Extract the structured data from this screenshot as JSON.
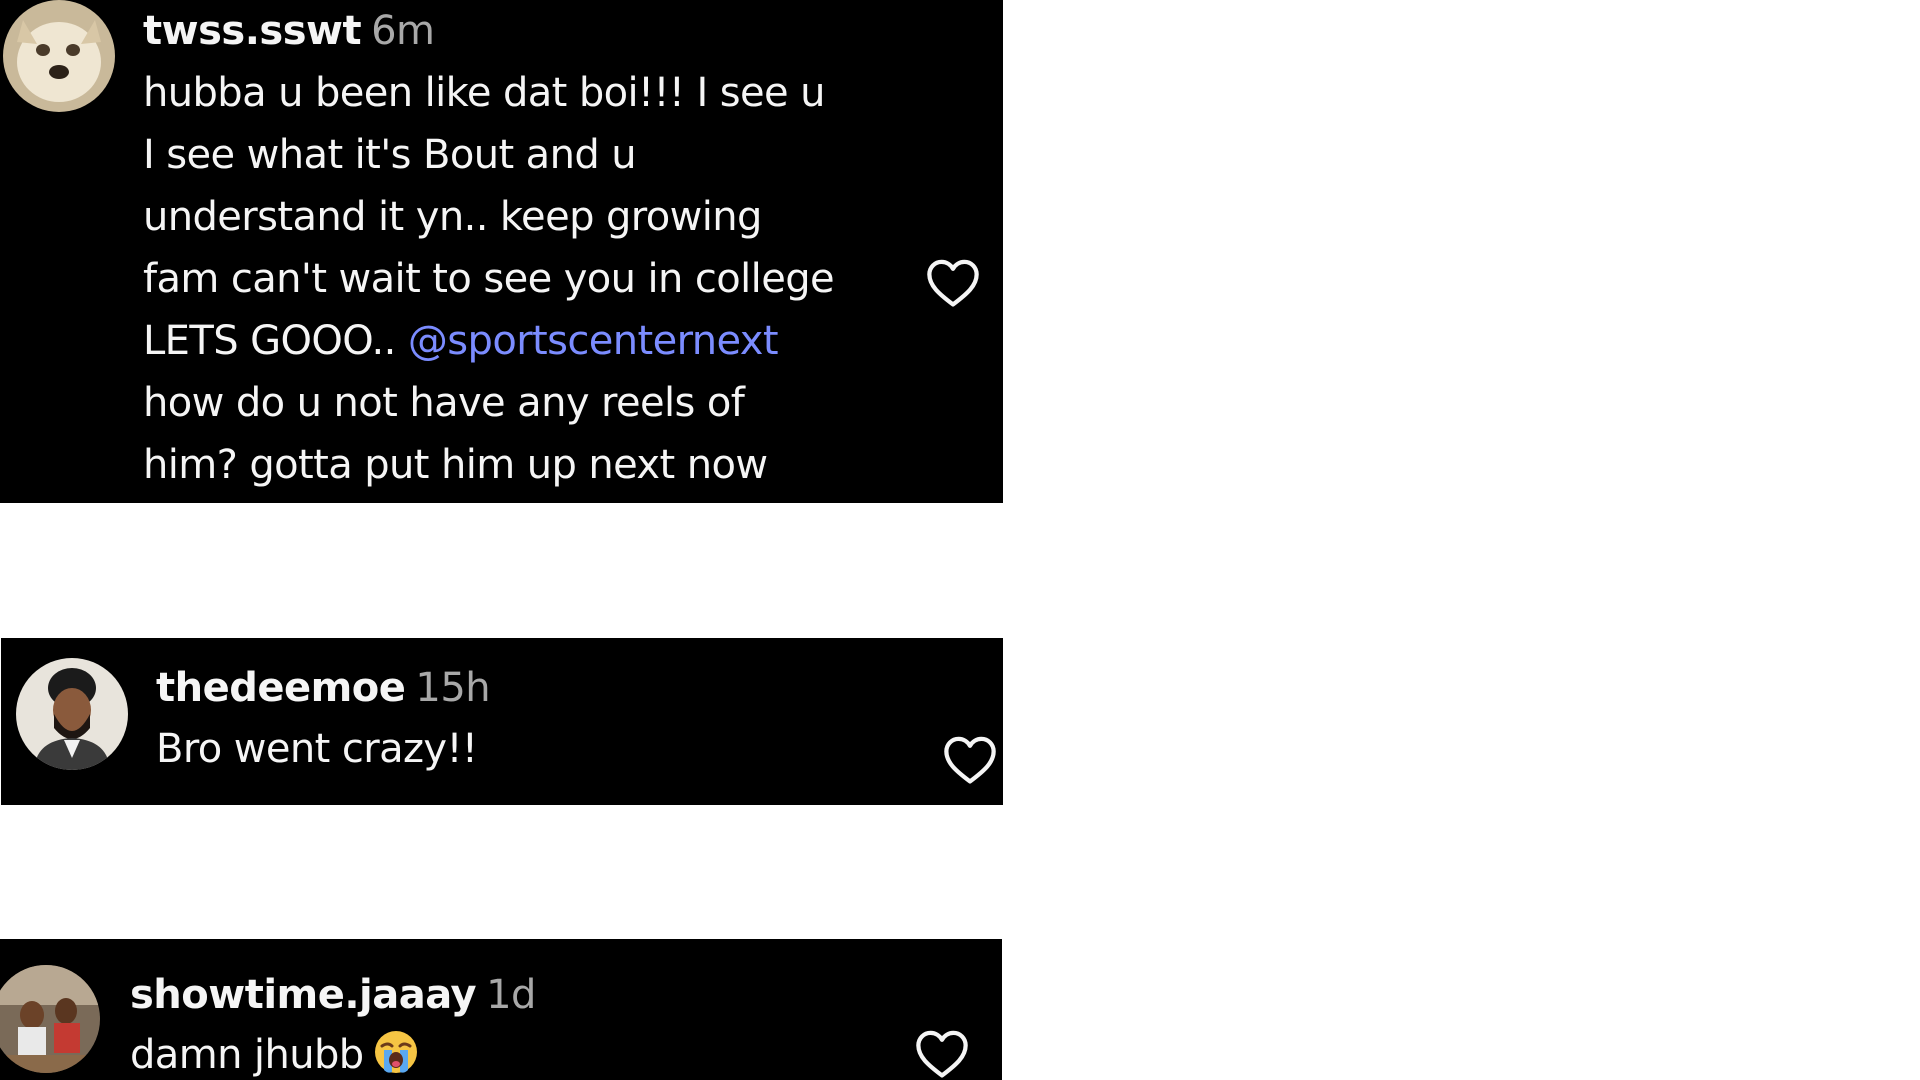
{
  "comments": [
    {
      "username": "twss.sswt",
      "time": "6m",
      "lines": [
        "hubba u been like dat boi!!! I see u",
        "I see what it's Bout and u",
        "understand it yn.. keep growing",
        "fam can't wait to see you in college",
        "LETS GOOO..",
        "how do u not have any reels of",
        "him? gotta put him up next now"
      ],
      "mention": "@sportscenternext"
    },
    {
      "username": "thedeemoe",
      "time": "15h",
      "text": "Bro went crazy!!"
    },
    {
      "username": "showtime.jaaay",
      "time": "1d",
      "text": "damn jhubb"
    }
  ],
  "icons": {
    "like": "heart-outline-icon",
    "emoji": "loudly-crying-face-emoji"
  },
  "colors": {
    "background": "#000000",
    "text": "#f5f5f5",
    "timestamp": "#a8a8a8",
    "mention": "#7b8cff"
  }
}
